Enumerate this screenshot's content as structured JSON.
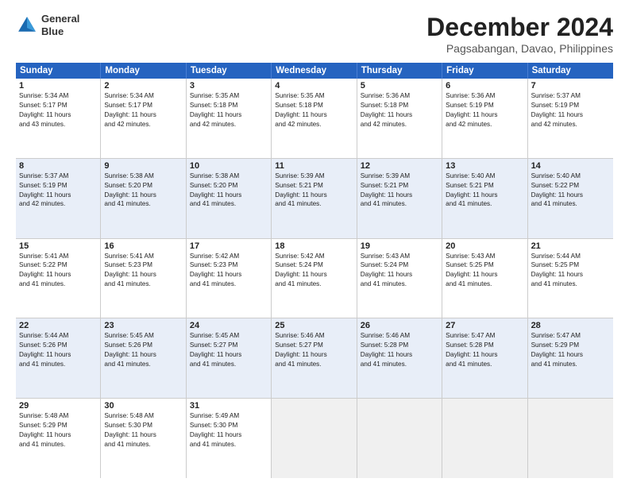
{
  "logo": {
    "line1": "General",
    "line2": "Blue"
  },
  "title": "December 2024",
  "subtitle": "Pagsabangan, Davao, Philippines",
  "header_days": [
    "Sunday",
    "Monday",
    "Tuesday",
    "Wednesday",
    "Thursday",
    "Friday",
    "Saturday"
  ],
  "rows": [
    {
      "alt": false,
      "cells": [
        {
          "day": "1",
          "text": "Sunrise: 5:34 AM\nSunset: 5:17 PM\nDaylight: 11 hours\nand 43 minutes."
        },
        {
          "day": "2",
          "text": "Sunrise: 5:34 AM\nSunset: 5:17 PM\nDaylight: 11 hours\nand 42 minutes."
        },
        {
          "day": "3",
          "text": "Sunrise: 5:35 AM\nSunset: 5:18 PM\nDaylight: 11 hours\nand 42 minutes."
        },
        {
          "day": "4",
          "text": "Sunrise: 5:35 AM\nSunset: 5:18 PM\nDaylight: 11 hours\nand 42 minutes."
        },
        {
          "day": "5",
          "text": "Sunrise: 5:36 AM\nSunset: 5:18 PM\nDaylight: 11 hours\nand 42 minutes."
        },
        {
          "day": "6",
          "text": "Sunrise: 5:36 AM\nSunset: 5:19 PM\nDaylight: 11 hours\nand 42 minutes."
        },
        {
          "day": "7",
          "text": "Sunrise: 5:37 AM\nSunset: 5:19 PM\nDaylight: 11 hours\nand 42 minutes."
        }
      ]
    },
    {
      "alt": true,
      "cells": [
        {
          "day": "8",
          "text": "Sunrise: 5:37 AM\nSunset: 5:19 PM\nDaylight: 11 hours\nand 42 minutes."
        },
        {
          "day": "9",
          "text": "Sunrise: 5:38 AM\nSunset: 5:20 PM\nDaylight: 11 hours\nand 41 minutes."
        },
        {
          "day": "10",
          "text": "Sunrise: 5:38 AM\nSunset: 5:20 PM\nDaylight: 11 hours\nand 41 minutes."
        },
        {
          "day": "11",
          "text": "Sunrise: 5:39 AM\nSunset: 5:21 PM\nDaylight: 11 hours\nand 41 minutes."
        },
        {
          "day": "12",
          "text": "Sunrise: 5:39 AM\nSunset: 5:21 PM\nDaylight: 11 hours\nand 41 minutes."
        },
        {
          "day": "13",
          "text": "Sunrise: 5:40 AM\nSunset: 5:21 PM\nDaylight: 11 hours\nand 41 minutes."
        },
        {
          "day": "14",
          "text": "Sunrise: 5:40 AM\nSunset: 5:22 PM\nDaylight: 11 hours\nand 41 minutes."
        }
      ]
    },
    {
      "alt": false,
      "cells": [
        {
          "day": "15",
          "text": "Sunrise: 5:41 AM\nSunset: 5:22 PM\nDaylight: 11 hours\nand 41 minutes."
        },
        {
          "day": "16",
          "text": "Sunrise: 5:41 AM\nSunset: 5:23 PM\nDaylight: 11 hours\nand 41 minutes."
        },
        {
          "day": "17",
          "text": "Sunrise: 5:42 AM\nSunset: 5:23 PM\nDaylight: 11 hours\nand 41 minutes."
        },
        {
          "day": "18",
          "text": "Sunrise: 5:42 AM\nSunset: 5:24 PM\nDaylight: 11 hours\nand 41 minutes."
        },
        {
          "day": "19",
          "text": "Sunrise: 5:43 AM\nSunset: 5:24 PM\nDaylight: 11 hours\nand 41 minutes."
        },
        {
          "day": "20",
          "text": "Sunrise: 5:43 AM\nSunset: 5:25 PM\nDaylight: 11 hours\nand 41 minutes."
        },
        {
          "day": "21",
          "text": "Sunrise: 5:44 AM\nSunset: 5:25 PM\nDaylight: 11 hours\nand 41 minutes."
        }
      ]
    },
    {
      "alt": true,
      "cells": [
        {
          "day": "22",
          "text": "Sunrise: 5:44 AM\nSunset: 5:26 PM\nDaylight: 11 hours\nand 41 minutes."
        },
        {
          "day": "23",
          "text": "Sunrise: 5:45 AM\nSunset: 5:26 PM\nDaylight: 11 hours\nand 41 minutes."
        },
        {
          "day": "24",
          "text": "Sunrise: 5:45 AM\nSunset: 5:27 PM\nDaylight: 11 hours\nand 41 minutes."
        },
        {
          "day": "25",
          "text": "Sunrise: 5:46 AM\nSunset: 5:27 PM\nDaylight: 11 hours\nand 41 minutes."
        },
        {
          "day": "26",
          "text": "Sunrise: 5:46 AM\nSunset: 5:28 PM\nDaylight: 11 hours\nand 41 minutes."
        },
        {
          "day": "27",
          "text": "Sunrise: 5:47 AM\nSunset: 5:28 PM\nDaylight: 11 hours\nand 41 minutes."
        },
        {
          "day": "28",
          "text": "Sunrise: 5:47 AM\nSunset: 5:29 PM\nDaylight: 11 hours\nand 41 minutes."
        }
      ]
    },
    {
      "alt": false,
      "cells": [
        {
          "day": "29",
          "text": "Sunrise: 5:48 AM\nSunset: 5:29 PM\nDaylight: 11 hours\nand 41 minutes."
        },
        {
          "day": "30",
          "text": "Sunrise: 5:48 AM\nSunset: 5:30 PM\nDaylight: 11 hours\nand 41 minutes."
        },
        {
          "day": "31",
          "text": "Sunrise: 5:49 AM\nSunset: 5:30 PM\nDaylight: 11 hours\nand 41 minutes."
        },
        {
          "day": "",
          "text": ""
        },
        {
          "day": "",
          "text": ""
        },
        {
          "day": "",
          "text": ""
        },
        {
          "day": "",
          "text": ""
        }
      ]
    }
  ]
}
